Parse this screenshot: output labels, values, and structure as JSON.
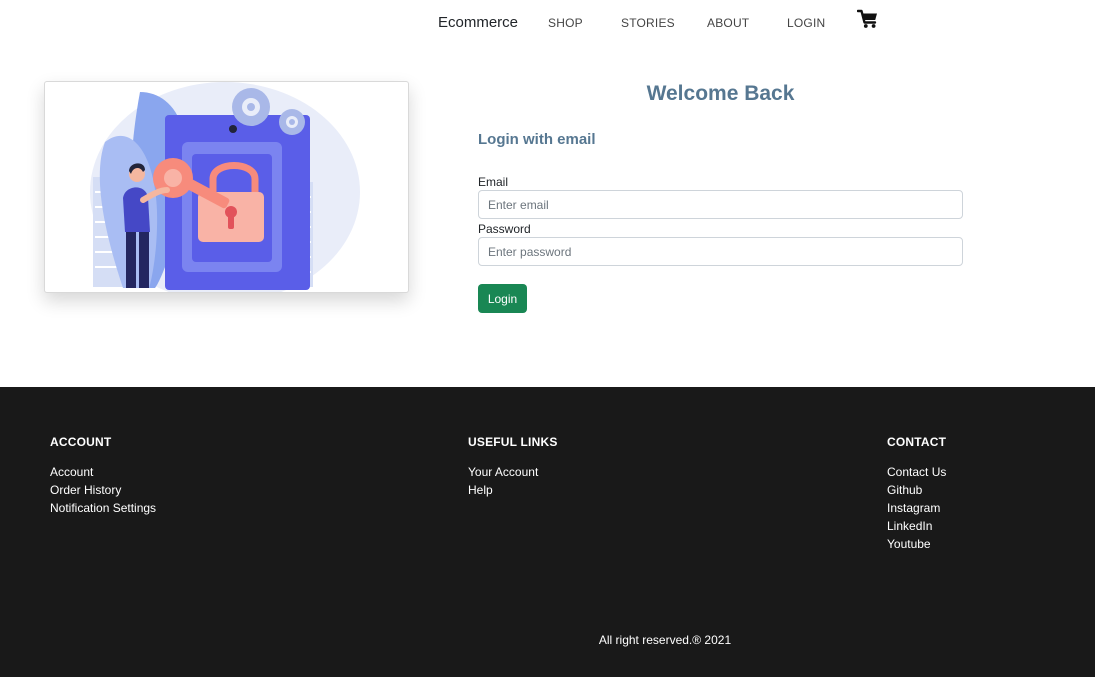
{
  "nav": {
    "brand": "Ecommerce",
    "links": [
      "SHOP",
      "STORIES",
      "ABOUT",
      "LOGIN"
    ],
    "cart_icon": "shopping-cart-icon"
  },
  "hero": {
    "illustration": "login-lock-key-illustration",
    "colors": {
      "primary": "#5a5ee8",
      "accent": "#f78b7c",
      "light": "#e6ebf8",
      "gear": "#a9b8e8"
    }
  },
  "login": {
    "title": "Welcome Back",
    "subtitle": "Login with email",
    "email_label": "Email",
    "email_placeholder": "Enter email",
    "password_label": "Password",
    "password_placeholder": "Enter password",
    "submit_label": "Login",
    "submit_color": "#198754",
    "heading_color": "#567791"
  },
  "footer": {
    "account": {
      "title": "ACCOUNT",
      "links": [
        "Account",
        "Order History",
        "Notification Settings"
      ]
    },
    "useful_links": {
      "title": "USEFUL LINKS",
      "links": [
        "Your Account",
        "Help"
      ]
    },
    "contact": {
      "title": "CONTACT",
      "links": [
        "Contact Us",
        "Github",
        "Instagram",
        "LinkedIn",
        "Youtube"
      ]
    },
    "copyright": "All right reserved.® 2021",
    "background": "#191919"
  }
}
